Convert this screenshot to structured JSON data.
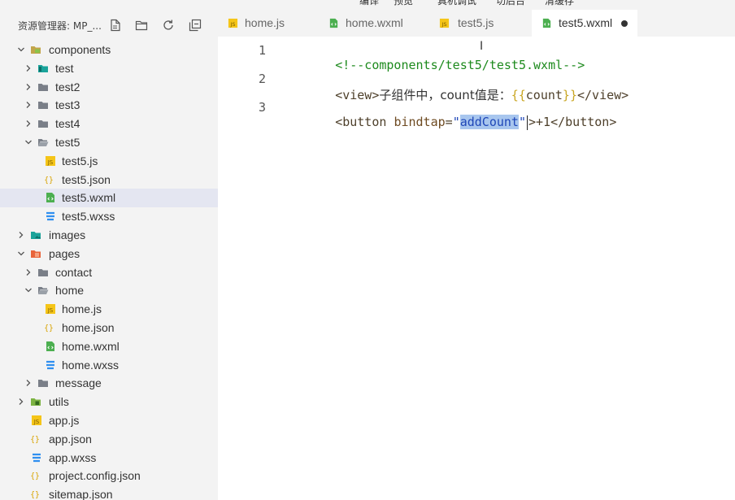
{
  "top_menu": [
    "编译",
    "预览",
    "真机调试",
    "切后台",
    "清缓存"
  ],
  "sidebar": {
    "title": "资源管理器: MP_...",
    "header_icons": [
      "new-file-icon",
      "new-folder-icon",
      "refresh-icon",
      "collapse-all-icon"
    ],
    "tree": [
      {
        "label": "components",
        "depth": 0,
        "type": "folder-special",
        "expanded": true
      },
      {
        "label": "test",
        "depth": 1,
        "type": "folder-teal",
        "expanded": false
      },
      {
        "label": "test2",
        "depth": 1,
        "type": "folder",
        "expanded": false
      },
      {
        "label": "test3",
        "depth": 1,
        "type": "folder",
        "expanded": false
      },
      {
        "label": "test4",
        "depth": 1,
        "type": "folder",
        "expanded": false
      },
      {
        "label": "test5",
        "depth": 1,
        "type": "folder-open",
        "expanded": true
      },
      {
        "label": "test5.js",
        "depth": 2,
        "type": "js"
      },
      {
        "label": "test5.json",
        "depth": 2,
        "type": "json"
      },
      {
        "label": "test5.wxml",
        "depth": 2,
        "type": "wxml",
        "selected": true
      },
      {
        "label": "test5.wxss",
        "depth": 2,
        "type": "wxss"
      },
      {
        "label": "images",
        "depth": 0,
        "type": "folder-images",
        "expanded": false
      },
      {
        "label": "pages",
        "depth": 0,
        "type": "folder-pages",
        "expanded": true
      },
      {
        "label": "contact",
        "depth": 1,
        "type": "folder",
        "expanded": false
      },
      {
        "label": "home",
        "depth": 1,
        "type": "folder-open",
        "expanded": true
      },
      {
        "label": "home.js",
        "depth": 2,
        "type": "js"
      },
      {
        "label": "home.json",
        "depth": 2,
        "type": "json"
      },
      {
        "label": "home.wxml",
        "depth": 2,
        "type": "wxml"
      },
      {
        "label": "home.wxss",
        "depth": 2,
        "type": "wxss"
      },
      {
        "label": "message",
        "depth": 1,
        "type": "folder",
        "expanded": false
      },
      {
        "label": "utils",
        "depth": 0,
        "type": "folder-utils",
        "expanded": false
      },
      {
        "label": "app.js",
        "depth": 0,
        "type": "js",
        "file": true
      },
      {
        "label": "app.json",
        "depth": 0,
        "type": "json",
        "file": true
      },
      {
        "label": "app.wxss",
        "depth": 0,
        "type": "wxss",
        "file": true
      },
      {
        "label": "project.config.json",
        "depth": 0,
        "type": "json",
        "file": true
      },
      {
        "label": "sitemap.json",
        "depth": 0,
        "type": "json",
        "file": true
      }
    ]
  },
  "tabs": [
    {
      "label": "home.js",
      "type": "js",
      "active": false
    },
    {
      "label": "home.wxml",
      "type": "wxml",
      "active": false
    },
    {
      "label": "test5.js",
      "type": "js",
      "active": false
    },
    {
      "label": "test5.wxml",
      "type": "wxml",
      "active": true,
      "dirty": true
    }
  ],
  "editor": {
    "lines": [
      {
        "num": "1",
        "tokens": [
          {
            "t": "comment",
            "v": "<!--components/test5/test5.wxml-->"
          }
        ]
      },
      {
        "num": "2",
        "tokens": [
          {
            "t": "tag",
            "v": "<view>"
          },
          {
            "t": "text",
            "v": "子组件中，count值是："
          },
          {
            "t": "brace",
            "v": "{{"
          },
          {
            "t": "tag",
            "v": "count"
          },
          {
            "t": "brace",
            "v": "}}"
          },
          {
            "t": "tag",
            "v": "</view>"
          }
        ]
      },
      {
        "num": "3",
        "tokens": [
          {
            "t": "tag",
            "v": "<button "
          },
          {
            "t": "attr",
            "v": "bindtap"
          },
          {
            "t": "tag",
            "v": "="
          },
          {
            "t": "str",
            "v": "\""
          },
          {
            "t": "selected",
            "v": "addCount"
          },
          {
            "t": "str",
            "v": "\""
          },
          {
            "t": "caret",
            "v": ""
          },
          {
            "t": "tag",
            "v": ">+1</button>"
          }
        ]
      }
    ]
  },
  "colors": {
    "sidebar_bg": "#f3f3f3",
    "selected_row": "#e4e6f1",
    "comment": "#1d8a1d",
    "string": "#1f47b8",
    "selection": "#a8c6ee"
  }
}
